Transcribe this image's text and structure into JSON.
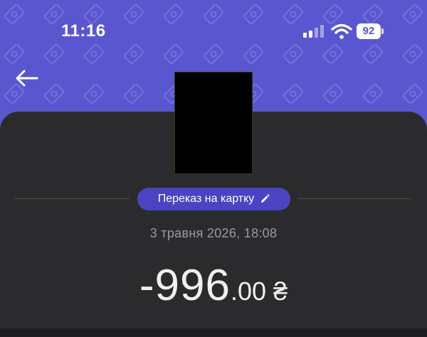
{
  "status_bar": {
    "time": "11:16",
    "battery_level": "92",
    "signal_icon": "signal-bars-icon",
    "wifi_icon": "wifi-icon"
  },
  "header": {
    "back_icon": "arrow-left-icon",
    "background_color": "#5a56cf"
  },
  "transaction": {
    "category_label": "Переказ на картку",
    "category_edit_icon": "pencil-icon",
    "date": "3 травня 2026, 18:08",
    "amount_integer": "-996",
    "amount_decimal": ".00",
    "currency": "₴",
    "recipient_avatar": "redacted"
  },
  "colors": {
    "accent": "#4b44c2",
    "card_background": "#2b2b2d",
    "secondary_text": "#9a9a9e"
  }
}
